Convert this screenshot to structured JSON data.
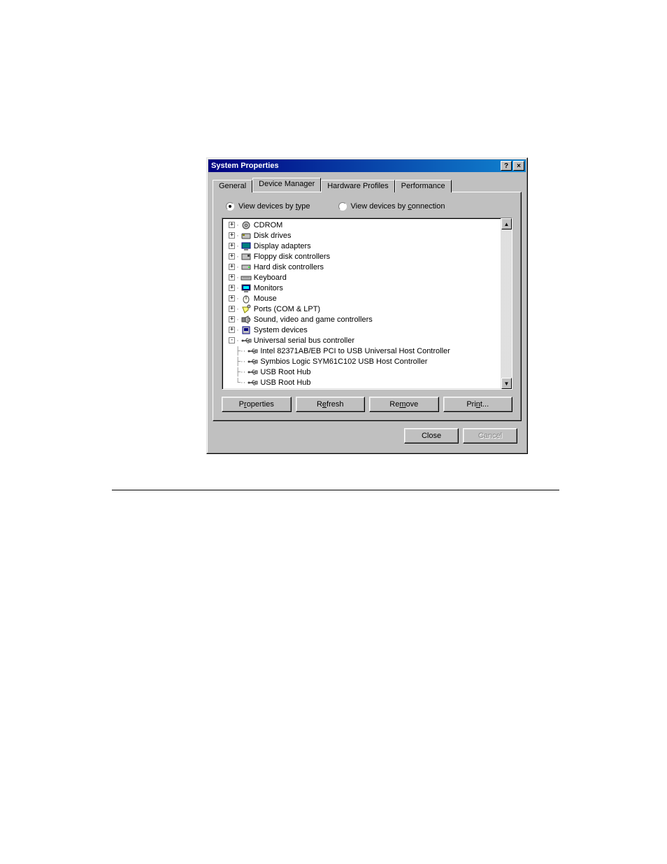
{
  "titlebar": {
    "title": "System Properties",
    "help_glyph": "?",
    "close_glyph": "×"
  },
  "tabs": {
    "items": [
      {
        "label": "General"
      },
      {
        "label": "Device Manager"
      },
      {
        "label": "Hardware Profiles"
      },
      {
        "label": "Performance"
      }
    ],
    "active_index": 1
  },
  "viewmode": {
    "by_type_prefix": "View devices by ",
    "by_type_key": "t",
    "by_type_suffix": "ype",
    "by_conn_prefix": "View devices by ",
    "by_conn_key": "c",
    "by_conn_suffix": "onnection",
    "selected": "type"
  },
  "tree": [
    {
      "level": 0,
      "expander": "+",
      "icon": "cdrom",
      "label": "CDROM"
    },
    {
      "level": 0,
      "expander": "+",
      "icon": "disk",
      "label": "Disk drives"
    },
    {
      "level": 0,
      "expander": "+",
      "icon": "display",
      "label": "Display adapters"
    },
    {
      "level": 0,
      "expander": "+",
      "icon": "floppy",
      "label": "Floppy disk controllers"
    },
    {
      "level": 0,
      "expander": "+",
      "icon": "hdd",
      "label": "Hard disk controllers"
    },
    {
      "level": 0,
      "expander": "+",
      "icon": "keyboard",
      "label": "Keyboard"
    },
    {
      "level": 0,
      "expander": "+",
      "icon": "monitor",
      "label": "Monitors"
    },
    {
      "level": 0,
      "expander": "+",
      "icon": "mouse",
      "label": "Mouse"
    },
    {
      "level": 0,
      "expander": "+",
      "icon": "ports",
      "label": "Ports (COM & LPT)"
    },
    {
      "level": 0,
      "expander": "+",
      "icon": "sound",
      "label": "Sound, video and game controllers"
    },
    {
      "level": 0,
      "expander": "+",
      "icon": "system",
      "label": "System devices"
    },
    {
      "level": 0,
      "expander": "-",
      "icon": "usb",
      "label": "Universal serial bus controller"
    },
    {
      "level": 1,
      "expander": "",
      "icon": "usb",
      "label": "Intel 82371AB/EB PCI to USB Universal Host Controller"
    },
    {
      "level": 1,
      "expander": "",
      "icon": "usb",
      "label": "Symbios Logic SYM61C102 USB Host Controller"
    },
    {
      "level": 1,
      "expander": "",
      "icon": "usb",
      "label": "USB Root Hub"
    },
    {
      "level": 1,
      "expander": "",
      "icon": "usb",
      "label": "USB Root Hub"
    }
  ],
  "action_buttons": {
    "properties": "Properties",
    "refresh": "Refresh",
    "remove": "Remove",
    "print": "Print..."
  },
  "dialog_buttons": {
    "close": "Close",
    "cancel": "Cancel"
  },
  "scroll": {
    "up": "▲",
    "down": "▼"
  }
}
